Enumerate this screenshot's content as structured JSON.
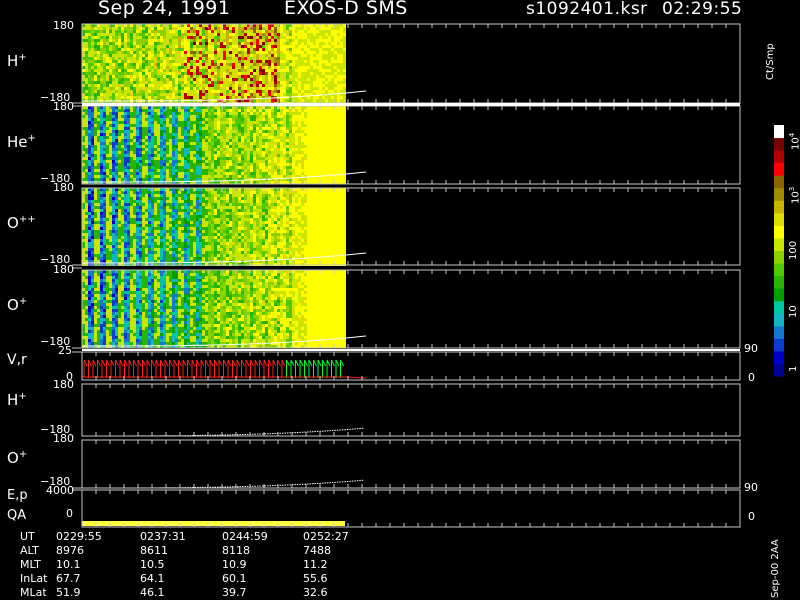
{
  "header": {
    "date": "Sep 24, 1991",
    "instrument": "EXOS-D SMS",
    "file": "s1092401.ksr",
    "time": "02:29:55"
  },
  "colorbar": {
    "unit": "Ct/Smp",
    "tick_labels": [
      "1",
      "10",
      "100",
      "10",
      "10"
    ],
    "tick_superscripts": [
      "",
      "",
      "",
      "3",
      "4"
    ],
    "colors": [
      "#000096",
      "#0000c8",
      "#0a3cd2",
      "#1478d2",
      "#14b4c8",
      "#00c8a0",
      "#00a000",
      "#28b400",
      "#50c800",
      "#8cd200",
      "#c8e600",
      "#ffff00",
      "#dcdc00",
      "#c8b400",
      "#a08c00",
      "#8c6400",
      "#ff0000",
      "#b40000",
      "#780000",
      "#ffffff"
    ]
  },
  "panels": {
    "h_plus": "H",
    "h_plus_sup": "+",
    "he_plus": "He",
    "he_plus_sup": "+",
    "o_pp": "O",
    "o_pp_sup": "++",
    "o_plus": "O",
    "o_plus_sup": "+",
    "vr": "V,r",
    "h_plus_2": "H",
    "h_plus_2_sup": "+",
    "o_plus_2": "O",
    "o_plus_2_sup": "+",
    "ep": "E,p",
    "qa": "QA"
  },
  "axis_labels": {
    "top_180": "180",
    "bottom_m180": "−180",
    "vr_top": "25",
    "vr_zero": "0",
    "ep_top": "4000",
    "ep_zero": "0",
    "right_90": "90",
    "right_0": "0"
  },
  "chart_data": {
    "type": "heatmap",
    "x": [
      "0229:55",
      "0237:31",
      "0244:59",
      "0252:27"
    ],
    "ephemeris": {
      "labels": [
        "UT",
        "ALT",
        "MLT",
        "InLat",
        "MLat"
      ],
      "rows": [
        [
          "0229:55",
          "0237:31",
          "0244:59",
          "0252:27"
        ],
        [
          "8976",
          "8611",
          "8118",
          "7488"
        ],
        [
          "10.1",
          "10.5",
          "10.9",
          "11.2"
        ],
        [
          "67.7",
          "64.1",
          "60.1",
          "55.6"
        ],
        [
          "51.9",
          "46.1",
          "39.7",
          "32.6"
        ]
      ]
    },
    "ylim_pitch": [
      -180,
      180
    ],
    "ylim_vr": [
      0,
      25
    ],
    "ylim_ep": [
      0,
      4000
    ],
    "ylim_right": [
      0,
      90
    ],
    "colorbar_unit": "Ct/Smp"
  },
  "footer": {
    "side_label": "Sep-00 2AA"
  }
}
